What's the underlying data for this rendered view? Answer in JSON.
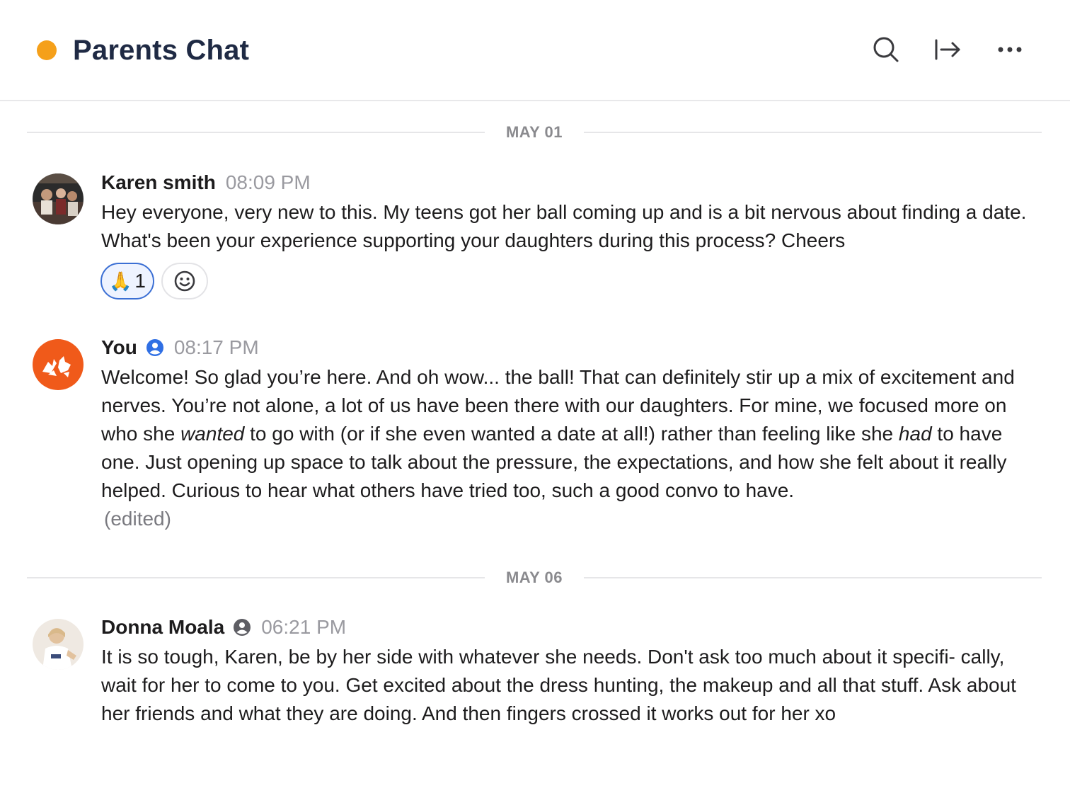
{
  "header": {
    "title": "Parents Chat",
    "status_color": "#f5a01a",
    "icons": [
      "search-icon",
      "exit-icon",
      "more-icon"
    ]
  },
  "dividers": [
    "MAY 01",
    "MAY 06"
  ],
  "messages": [
    {
      "author": "Karen smith",
      "time": "08:09 PM",
      "text": "Hey everyone, very new to this. My teens got her ball coming up and is a bit nervous about finding a date. What's been your experience supporting your daughters during this process? Cheers",
      "reactions": [
        {
          "emoji": "🙏",
          "count": "1"
        }
      ]
    },
    {
      "author": "You",
      "time": "08:17 PM",
      "text_parts": [
        "Welcome! So glad you’re here. And oh wow... the ball! That can definitely stir up a mix of excitement and nerves. You’re not alone, a lot of us have been there with our daughters. For mine, we focused more on who she ",
        "wanted",
        " to go with (or if she even wanted a date at all!) rather than feeling like she ",
        "had",
        " to have one. Just opening up space to talk about the pressure, the expectations, and how she felt about it really helped. Curious to hear what others have tried too, such a good convo to have."
      ],
      "edited": "(edited)",
      "avatar_color": "#f05a1a"
    },
    {
      "author": "Donna Moala",
      "time": "06:21 PM",
      "text": "It is so tough, Karen,  be by her side with whatever she needs.  Don't ask too much about it specifi- cally, wait for her to come to you.  Get excited about the dress hunting, the makeup and all that stuff.  Ask about her friends and what they are doing.  And then fingers crossed it works out for her xo"
    }
  ]
}
